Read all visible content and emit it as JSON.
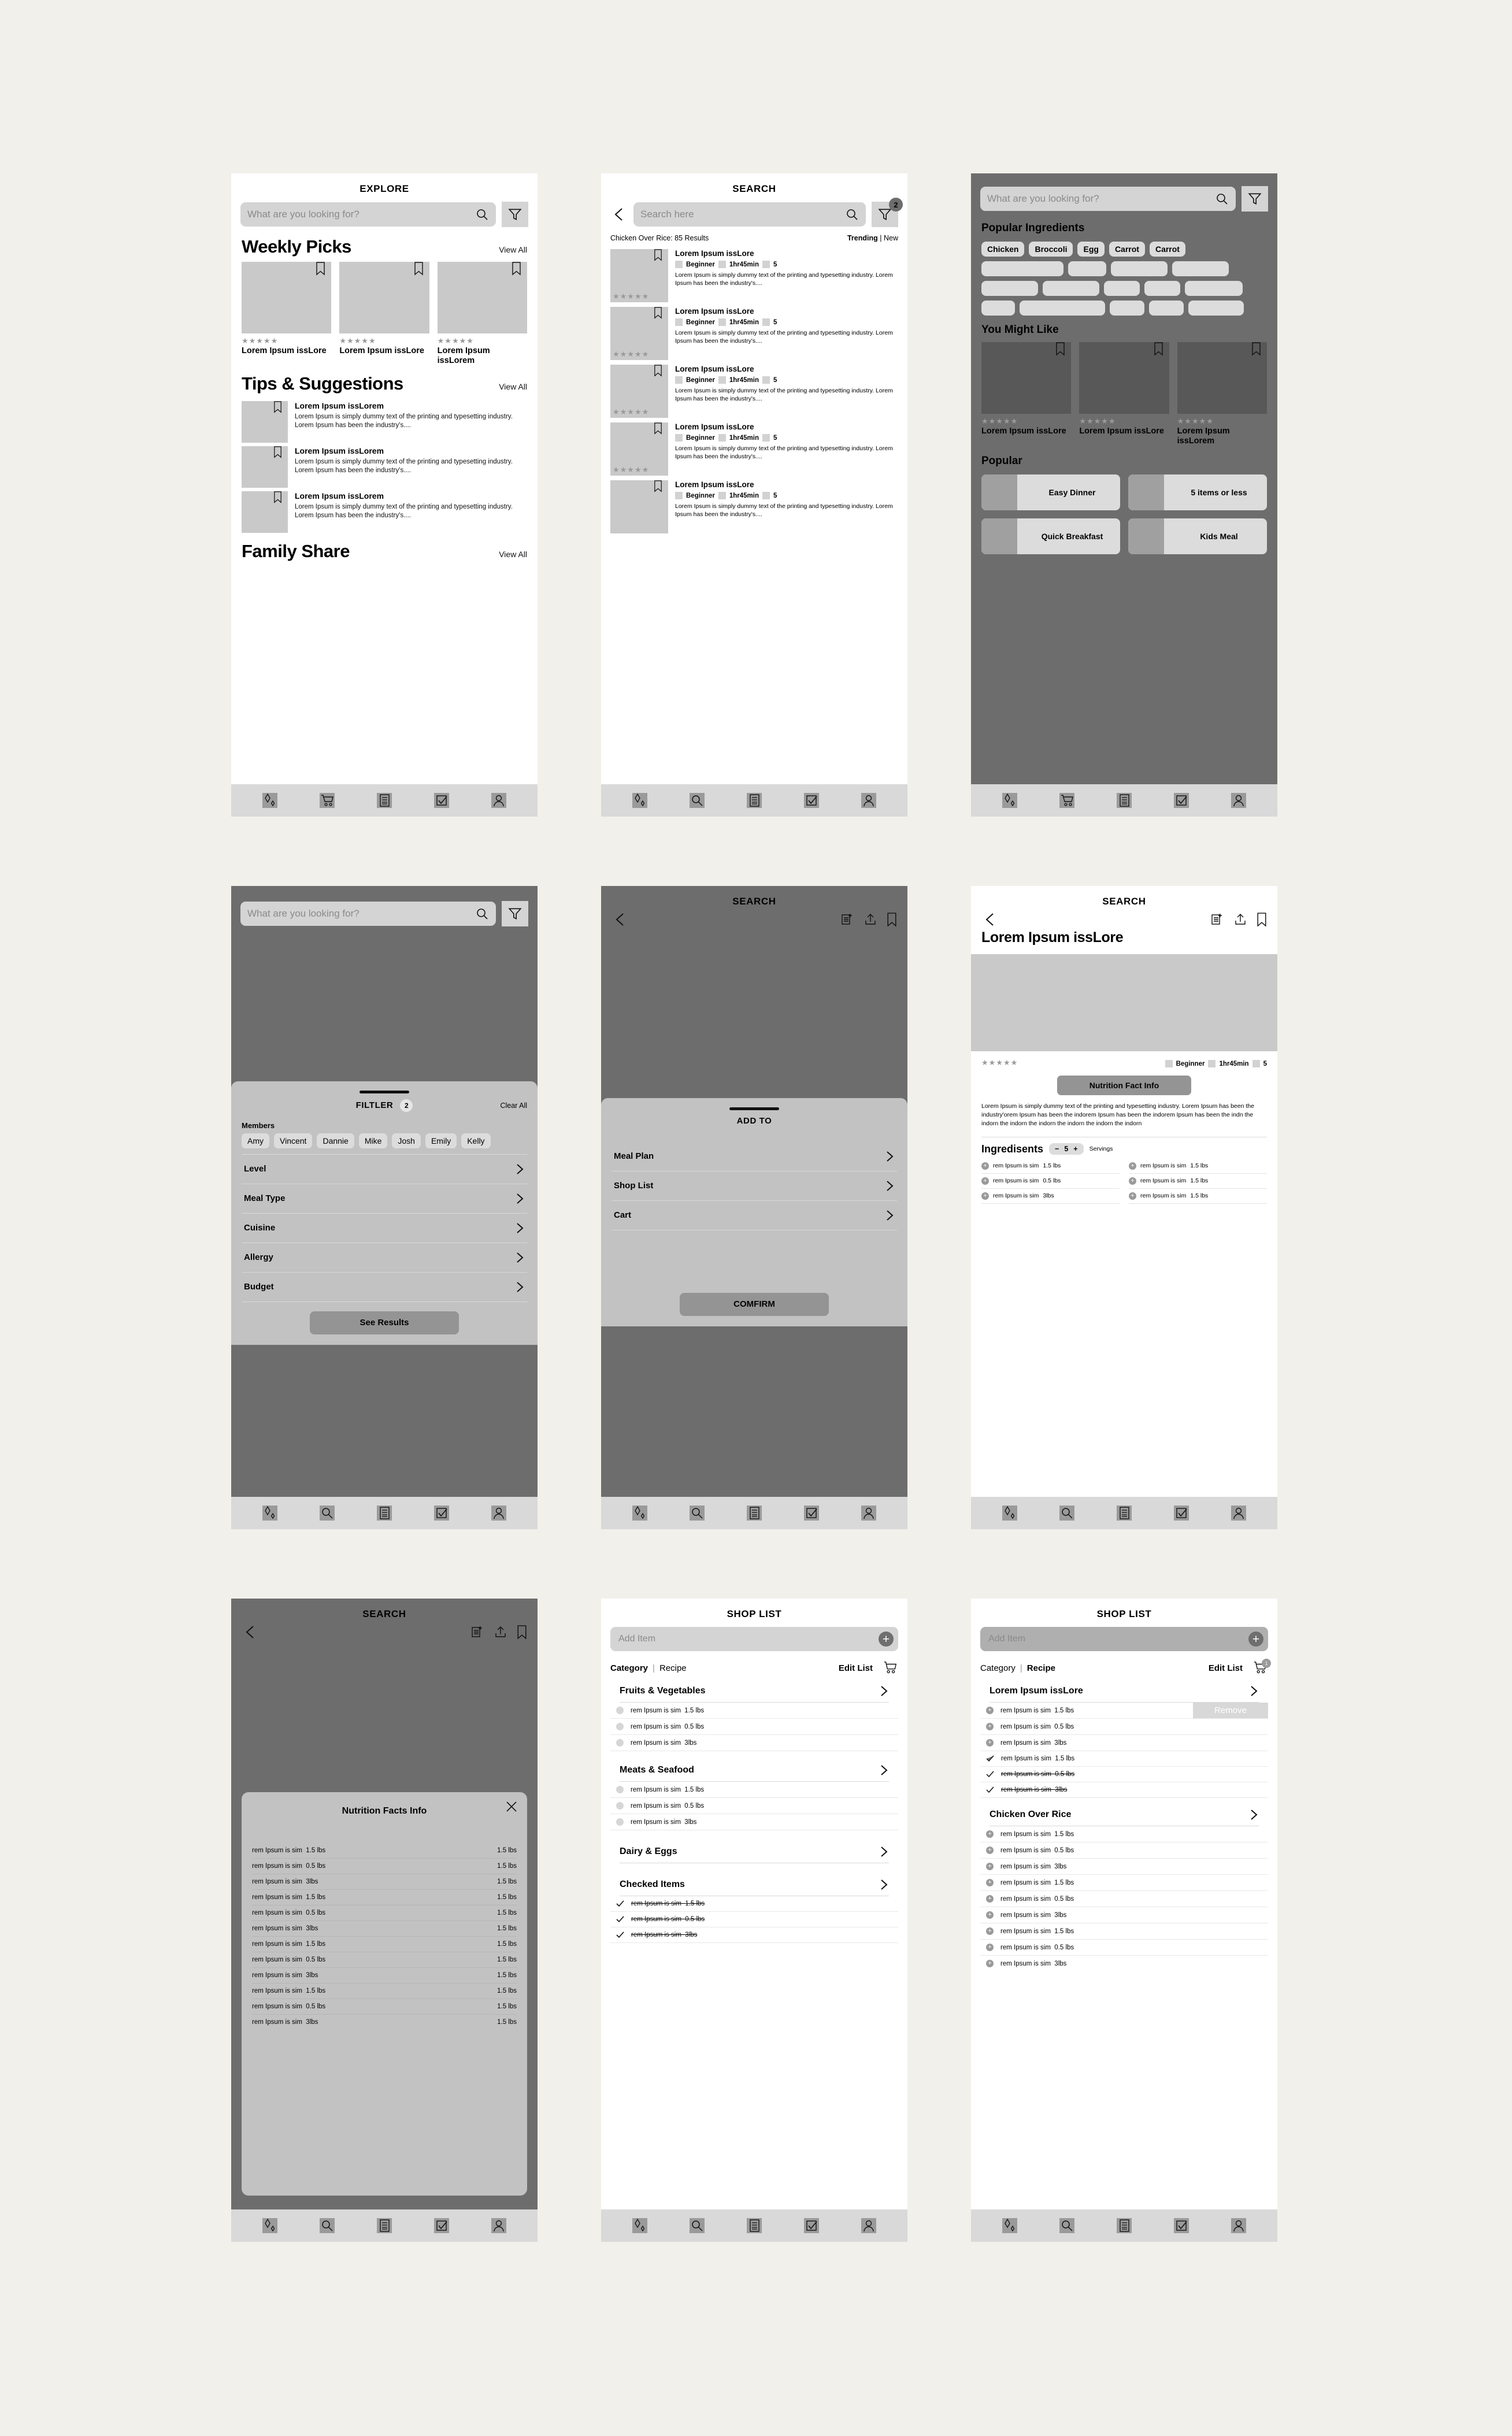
{
  "screens": {
    "explore": {
      "title": "EXPLORE",
      "search_placeholder": "What are you looking for?",
      "weekly": {
        "heading": "Weekly Picks",
        "view_all": "View All",
        "cards": [
          {
            "stars": "★★★★★",
            "name": "Lorem Ipsum issLore"
          },
          {
            "stars": "★★★★★",
            "name": "Lorem Ipsum issLore"
          },
          {
            "stars": "★★★★★",
            "name": "Lorem Ipsum issLorem"
          }
        ]
      },
      "tips": {
        "heading": "Tips & Suggestions",
        "view_all": "View All",
        "items": [
          {
            "title": "Lorem Ipsum issLorem",
            "body": "Lorem Ipsum is simply dummy text of the printing and typesetting industry. Lorem Ipsum has been the industry's...."
          },
          {
            "title": "Lorem Ipsum issLorem",
            "body": "Lorem Ipsum is simply dummy text of the printing and typesetting industry. Lorem Ipsum has been the industry's...."
          },
          {
            "title": "Lorem Ipsum issLorem",
            "body": "Lorem Ipsum is simply dummy text of the printing and typesetting industry. Lorem Ipsum has been the industry's...."
          }
        ]
      },
      "family": {
        "heading": "Family Share",
        "view_all": "View All"
      }
    },
    "search": {
      "title": "SEARCH",
      "search_placeholder": "Search here",
      "filter_badge": "2",
      "results_label": "Chicken Over Rice: 85 Results",
      "sort_trending": "Trending",
      "sort_sep": "|",
      "sort_new": "New",
      "results": [
        {
          "title": "Lorem Ipsum issLore",
          "stars": "★★★★★",
          "level": "Beginner",
          "time": "1hr45min",
          "servings": "5",
          "body": "Lorem Ipsum is simply dummy text of the printing and typesetting industry. Lorem Ipsum has been the industry's...."
        },
        {
          "title": "Lorem Ipsum issLore",
          "stars": "★★★★★",
          "level": "Beginner",
          "time": "1hr45min",
          "servings": "5",
          "body": "Lorem Ipsum is simply dummy text of the printing and typesetting industry. Lorem Ipsum has been the industry's...."
        },
        {
          "title": "Lorem Ipsum issLore",
          "stars": "★★★★★",
          "level": "Beginner",
          "time": "1hr45min",
          "servings": "5",
          "body": "Lorem Ipsum is simply dummy text of the printing and typesetting industry. Lorem Ipsum has been the industry's...."
        },
        {
          "title": "Lorem Ipsum issLore",
          "stars": "★★★★★",
          "level": "Beginner",
          "time": "1hr45min",
          "servings": "5",
          "body": "Lorem Ipsum is simply dummy text of the printing and typesetting industry. Lorem Ipsum has been the industry's...."
        },
        {
          "title": "Lorem Ipsum issLore",
          "stars": "★★★★★",
          "level": "Beginner",
          "time": "1hr45min",
          "servings": "5",
          "body": "Lorem Ipsum is simply dummy text of the printing and typesetting industry. Lorem Ipsum has been the industry's...."
        }
      ]
    },
    "discover": {
      "search_placeholder": "What are you looking for?",
      "popular_ingredients_heading": "Popular Ingredients",
      "ingredient_chips": [
        "Chicken",
        "Broccoli",
        "Egg",
        "Carrot",
        "Carrot"
      ],
      "you_might_like_heading": "You Might Like",
      "you_might_like": [
        {
          "stars": "★★★★★",
          "name": "Lorem Ipsum issLore"
        },
        {
          "stars": "★★★★★",
          "name": "Lorem Ipsum issLore"
        },
        {
          "stars": "★★★★★",
          "name": "Lorem Ipsum issLorem"
        }
      ],
      "popular_heading": "Popular",
      "popular_cards": [
        "Easy Dinner",
        "5 items or less",
        "Quick Breakfast",
        "Kids Meal"
      ]
    },
    "filter": {
      "search_placeholder": "What are you looking for?",
      "sheet_title": "FILTLER",
      "count": "2",
      "clear_all": "Clear All",
      "members_label": "Members",
      "members": [
        "Amy",
        "Vincent",
        "Dannie",
        "Mike",
        "Josh",
        "Emily",
        "Kelly"
      ],
      "rows": [
        "Level",
        "Meal Type",
        "Cuisine",
        "Allergy",
        "Budget"
      ],
      "cta": "See Results"
    },
    "addto": {
      "title": "SEARCH",
      "sheet_title": "ADD TO",
      "rows": [
        "Meal Plan",
        "Shop List",
        "Cart"
      ],
      "cta": "COMFIRM"
    },
    "recipe": {
      "title": "SEARCH",
      "name": "Lorem Ipsum issLore",
      "stars": "★★★★★",
      "level": "Beginner",
      "time": "1hr45min",
      "servings_count": "5",
      "nutrition_button": "Nutrition Fact Info",
      "description": "Lorem Ipsum is simply dummy text of the printing and typesetting industry. Lorem Ipsum has been the industry'orem Ipsum has been the indorem Ipsum has been the indorem Ipsum has been the indn the indorn the indorn the indorn the indorn the indorn the indorn",
      "ingredients_heading": "Ingredisents",
      "stepper": {
        "minus": "−",
        "value": "5",
        "plus": "+"
      },
      "servings_label": "Servings",
      "ingredients": [
        {
          "name": "rem Ipsum is sim",
          "qty": "1.5 lbs"
        },
        {
          "name": "rem Ipsum is sim",
          "qty": "1.5 lbs"
        },
        {
          "name": "rem Ipsum is sim",
          "qty": "0.5 lbs"
        },
        {
          "name": "rem Ipsum is sim",
          "qty": "1.5 lbs"
        },
        {
          "name": "rem Ipsum is sim",
          "qty": "3lbs"
        },
        {
          "name": "rem Ipsum is sim",
          "qty": "1.5 lbs"
        }
      ]
    },
    "nutrition_modal": {
      "title": "SEARCH",
      "modal_title": "Nutrition Facts Info",
      "rows": [
        {
          "name": "rem Ipsum is sim",
          "qty": "1.5 lbs",
          "value": "1.5 lbs"
        },
        {
          "name": "rem Ipsum is sim",
          "qty": "0.5 lbs",
          "value": "1.5 lbs"
        },
        {
          "name": "rem Ipsum is sim",
          "qty": "3lbs",
          "value": "1.5 lbs"
        },
        {
          "name": "rem Ipsum is sim",
          "qty": "1.5 lbs",
          "value": "1.5 lbs"
        },
        {
          "name": "rem Ipsum is sim",
          "qty": "0.5 lbs",
          "value": "1.5 lbs"
        },
        {
          "name": "rem Ipsum is sim",
          "qty": "3lbs",
          "value": "1.5 lbs"
        },
        {
          "name": "rem Ipsum is sim",
          "qty": "1.5 lbs",
          "value": "1.5 lbs"
        },
        {
          "name": "rem Ipsum is sim",
          "qty": "0.5 lbs",
          "value": "1.5 lbs"
        },
        {
          "name": "rem Ipsum is sim",
          "qty": "3lbs",
          "value": "1.5 lbs"
        },
        {
          "name": "rem Ipsum is sim",
          "qty": "1.5 lbs",
          "value": "1.5 lbs"
        },
        {
          "name": "rem Ipsum is sim",
          "qty": "0.5 lbs",
          "value": "1.5 lbs"
        },
        {
          "name": "rem Ipsum is sim",
          "qty": "3lbs",
          "value": "1.5 lbs"
        }
      ]
    },
    "shoplist_category": {
      "title": "SHOP LIST",
      "add_placeholder": "Add Item",
      "tab_category": "Category",
      "tab_sep": "|",
      "tab_recipe": "Recipe",
      "edit_list": "Edit List",
      "sections": [
        {
          "name": "Fruits & Vegetables",
          "items": [
            {
              "name": "rem Ipsum is sim",
              "qty": "1.5 lbs",
              "checked": false
            },
            {
              "name": "rem Ipsum is sim",
              "qty": "0.5 lbs",
              "checked": false
            },
            {
              "name": "rem Ipsum is sim",
              "qty": "3lbs",
              "checked": false
            }
          ]
        },
        {
          "name": "Meats  & Seafood",
          "items": [
            {
              "name": "rem Ipsum is sim",
              "qty": "1.5 lbs",
              "checked": false
            },
            {
              "name": "rem Ipsum is sim",
              "qty": "0.5 lbs",
              "checked": false
            },
            {
              "name": "rem Ipsum is sim",
              "qty": "3lbs",
              "checked": false
            }
          ]
        },
        {
          "name": "Dairy & Eggs",
          "items": []
        },
        {
          "name": "Checked Items",
          "items": [
            {
              "name": "rem Ipsum is sim",
              "qty": "1.5 lbs",
              "checked": true
            },
            {
              "name": "rem Ipsum is sim",
              "qty": "0.5 lbs",
              "checked": true
            },
            {
              "name": "rem Ipsum is sim",
              "qty": "3lbs",
              "checked": true
            }
          ]
        }
      ]
    },
    "shoplist_recipe": {
      "title": "SHOP LIST",
      "add_placeholder": "Add Item",
      "tab_category": "Category",
      "tab_sep": "|",
      "tab_recipe": "Recipe",
      "edit_list": "Edit List",
      "cart_badge": "1",
      "remove_label": "Remove",
      "sections": [
        {
          "name": "Lorem Ipsum issLore",
          "items": [
            {
              "name": "rem Ipsum is sim",
              "qty": "1.5 lbs",
              "state": "plus",
              "showRemove": true
            },
            {
              "name": "rem Ipsum is sim",
              "qty": "0.5 lbs",
              "state": "plus"
            },
            {
              "name": "rem Ipsum is sim",
              "qty": "3lbs",
              "state": "plus"
            },
            {
              "name": "rem Ipsum is sim",
              "qty": "1.5 lbs",
              "state": "check-dark"
            },
            {
              "name": "rem Ipsum is sim",
              "qty": "0.5 lbs",
              "state": "check-strike"
            },
            {
              "name": "rem Ipsum is sim",
              "qty": "3lbs",
              "state": "check-strike"
            }
          ]
        },
        {
          "name": "Chicken Over Rice",
          "items": [
            {
              "name": "rem Ipsum is sim",
              "qty": "1.5 lbs",
              "state": "plus"
            },
            {
              "name": "rem Ipsum is sim",
              "qty": "0.5 lbs",
              "state": "plus"
            },
            {
              "name": "rem Ipsum is sim",
              "qty": "3lbs",
              "state": "plus"
            },
            {
              "name": "rem Ipsum is sim",
              "qty": "1.5 lbs",
              "state": "plus"
            },
            {
              "name": "rem Ipsum is sim",
              "qty": "0.5 lbs",
              "state": "plus"
            },
            {
              "name": "rem Ipsum is sim",
              "qty": "3lbs",
              "state": "plus"
            },
            {
              "name": "rem Ipsum is sim",
              "qty": "1.5 lbs",
              "state": "plus"
            },
            {
              "name": "rem Ipsum is sim",
              "qty": "0.5 lbs",
              "state": "plus"
            },
            {
              "name": "rem Ipsum is sim",
              "qty": "3lbs",
              "state": "plus"
            }
          ]
        }
      ]
    }
  },
  "nav": {
    "items": [
      "sparkle-icon",
      "cart-icon",
      "list-icon",
      "checkbox-icon",
      "profile-icon"
    ],
    "items_search": [
      "sparkle-icon",
      "search-icon",
      "list-icon",
      "checkbox-icon",
      "profile-icon"
    ]
  },
  "colors": {
    "canvas": "#f2f0eb",
    "screen_light": "#ffffff",
    "screen_dark": "#6d6d6d",
    "placeholder_gray": "#c9c9c9",
    "chip_gray": "#dcdcdc",
    "button_gray": "#949494",
    "nav_bar": "#d9d9d9"
  }
}
